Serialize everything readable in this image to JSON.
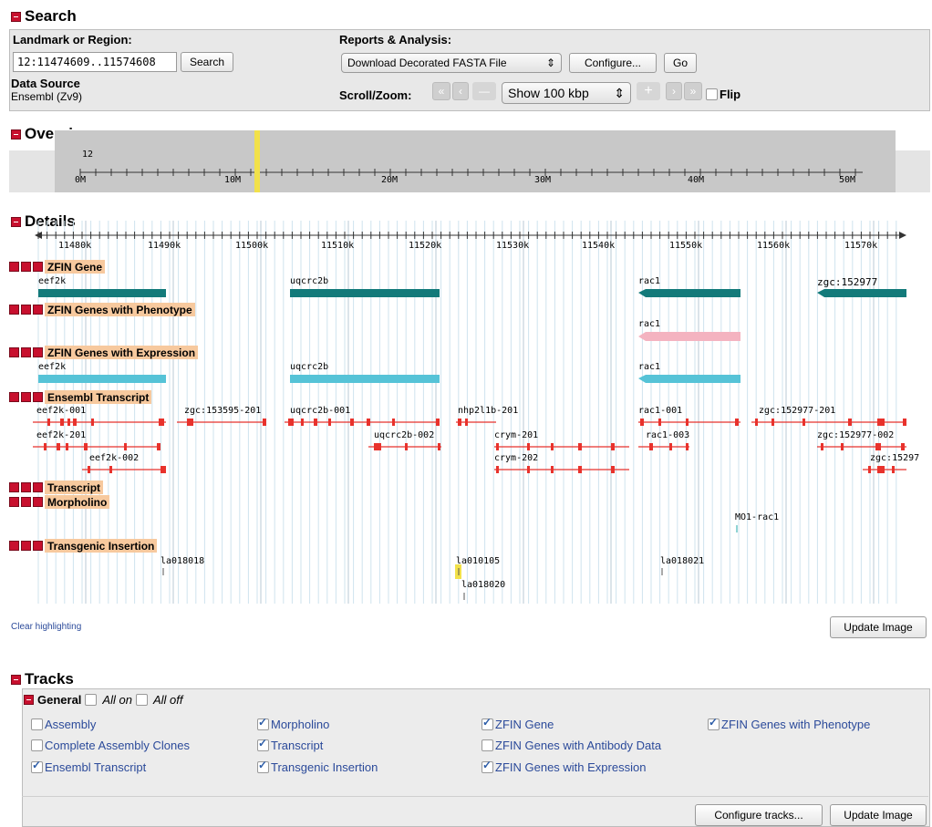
{
  "search": {
    "header": "Search",
    "landmark_label": "Landmark or Region:",
    "landmark_value": "12:11474609..11574608",
    "search_button": "Search",
    "data_source_label": "Data Source",
    "data_source_value": "Ensembl (Zv9)",
    "reports_label": "Reports & Analysis:",
    "reports_value": "Download Decorated FASTA File",
    "configure_button": "Configure...",
    "go_button": "Go",
    "scroll_label": "Scroll/Zoom:",
    "zoom_value": "Show 100 kbp",
    "flip_label": "Flip"
  },
  "overview": {
    "header": "Overview",
    "chrom": "12",
    "ticks": [
      "0M",
      "10M",
      "20M",
      "30M",
      "40M",
      "50M"
    ]
  },
  "details": {
    "header": "Details",
    "ticks": [
      "11480k",
      "11490k",
      "11500k",
      "11510k",
      "11520k",
      "11530k",
      "11540k",
      "11550k",
      "11560k",
      "11570k"
    ],
    "tracks": {
      "zfin_gene": "ZFIN Gene",
      "zfin_pheno": "ZFIN Genes with Phenotype",
      "zfin_expr": "ZFIN Genes with Expression",
      "ensembl": "Ensembl Transcript",
      "transcript": "Transcript",
      "morpholino": "Morpholino",
      "transgenic": "Transgenic Insertion"
    },
    "genes": {
      "g1": "eef2k",
      "g2": "uqcrc2b",
      "g3": "rac1",
      "g4": "zgc:152977",
      "p1": "rac1",
      "e1": "eef2k",
      "e2": "uqcrc2b",
      "e3": "rac1",
      "t1": "eef2k-001",
      "t2": "zgc:153595-201",
      "t3": "uqcrc2b-001",
      "t4": "nhp2l1b-201",
      "t5": "rac1-001",
      "t6": "zgc:152977-201",
      "t7": "eef2k-201",
      "t8": "uqcrc2b-002",
      "t9": "crym-201",
      "t10": "rac1-003",
      "t11": "zgc:152977-002",
      "t12": "eef2k-002",
      "t13": "crym-202",
      "t14": "zgc:15297",
      "m1": "MO1-rac1",
      "i1": "la018018",
      "i2": "la010105",
      "i3": "la018020",
      "i4": "la018021"
    },
    "clear_link": "Clear highlighting",
    "update_button": "Update Image"
  },
  "tracks": {
    "header": "Tracks",
    "general": "General",
    "all_on": "All on",
    "all_off": "All off",
    "items": {
      "assembly": "Assembly",
      "clones": "Complete Assembly Clones",
      "ensembl": "Ensembl Transcript",
      "morpholino": "Morpholino",
      "transcript": "Transcript",
      "transgenic": "Transgenic Insertion",
      "zfin_gene": "ZFIN Gene",
      "zfin_antibody": "ZFIN Genes with Antibody Data",
      "zfin_expr": "ZFIN Genes with Expression",
      "zfin_pheno": "ZFIN Genes with Phenotype"
    },
    "configure_button": "Configure tracks...",
    "update_button": "Update Image"
  },
  "colors": {
    "gene": "#137a7a",
    "pheno": "#f4b3c0",
    "expr": "#56c3d7",
    "transcript": "#e8322c",
    "highlight": "#f2e14a",
    "accent": "#c8102e"
  }
}
